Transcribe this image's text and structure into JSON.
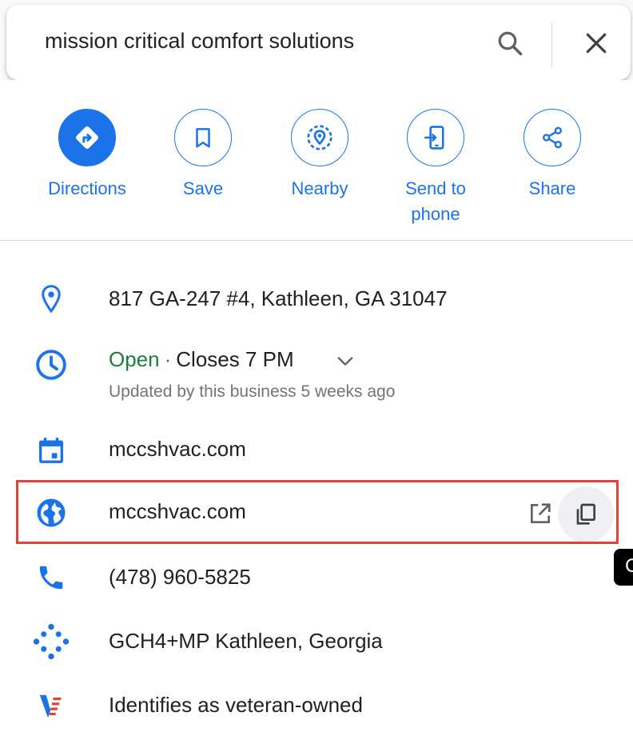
{
  "search": {
    "query": "mission critical comfort solutions"
  },
  "actions": [
    {
      "label": "Directions"
    },
    {
      "label": "Save"
    },
    {
      "label": "Nearby"
    },
    {
      "label": "Send to\nphone",
      "line1": "Send to",
      "line2": "phone"
    },
    {
      "label": "Share"
    }
  ],
  "info": {
    "address": "817 GA-247 #4, Kathleen, GA 31047",
    "hours_status": "Open",
    "hours_separator": "·",
    "hours_closes": "Closes 7 PM",
    "hours_updated": "Updated by this business 5 weeks ago",
    "booking_site": "mccshvac.com",
    "website": "mccshvac.com",
    "phone": "(478) 960-5825",
    "plus_code": "GCH4+MP Kathleen, Georgia",
    "veteran": "Identifies as veteran-owned"
  },
  "tooltip": {
    "text": "C"
  },
  "colors": {
    "accent": "#1a73e8",
    "open_green": "#188038",
    "highlight": "#e34133"
  }
}
